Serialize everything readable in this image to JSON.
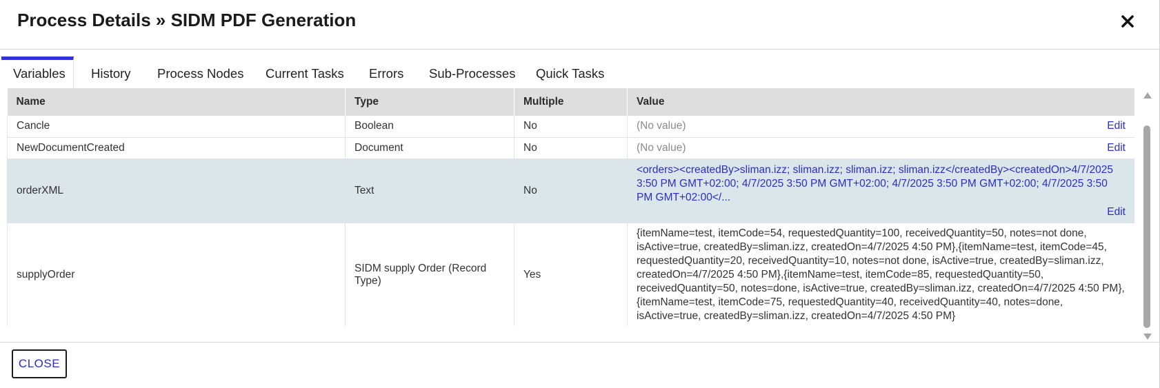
{
  "dialog": {
    "title": "Process Details » SIDM PDF Generation"
  },
  "tabs": [
    {
      "label": "Variables"
    },
    {
      "label": "History"
    },
    {
      "label": "Process Nodes"
    },
    {
      "label": "Current Tasks"
    },
    {
      "label": "Errors"
    },
    {
      "label": "Sub-Processes"
    },
    {
      "label": "Quick Tasks"
    }
  ],
  "table": {
    "headers": [
      "Name",
      "Type",
      "Multiple",
      "Value"
    ],
    "rows": [
      {
        "name": "Cancle",
        "type": "Boolean",
        "multiple": "No",
        "value": "(No value)",
        "edit": "Edit"
      },
      {
        "name": "NewDocumentCreated",
        "type": "Document",
        "multiple": "No",
        "value": "(No value)",
        "edit": "Edit"
      },
      {
        "name": "orderXML",
        "type": "Text",
        "multiple": "No",
        "value": "<orders><createdBy>sliman.izz; sliman.izz; sliman.izz; sliman.izz</createdBy><createdOn>4/7/2025 3:50 PM GMT+02:00; 4/7/2025 3:50 PM GMT+02:00; 4/7/2025 3:50 PM GMT+02:00; 4/7/2025 3:50 PM GMT+02:00</...",
        "edit": "Edit"
      },
      {
        "name": "supplyOrder",
        "type": "SIDM supply Order (Record Type)",
        "multiple": "Yes",
        "value": "{itemName=test, itemCode=54, requestedQuantity=100, receivedQuantity=50, notes=not done, isActive=true, createdBy=sliman.izz, createdOn=4/7/2025 4:50 PM},{itemName=test, itemCode=45, requestedQuantity=20, receivedQuantity=10, notes=not done, isActive=true, createdBy=sliman.izz, createdOn=4/7/2025 4:50 PM},{itemName=test, itemCode=85, requestedQuantity=50, receivedQuantity=50, notes=done, isActive=true, createdBy=sliman.izz, createdOn=4/7/2025 4:50 PM},{itemName=test, itemCode=75, requestedQuantity=40, receivedQuantity=40, notes=done, isActive=true, createdBy=sliman.izz, createdOn=4/7/2025 4:50 PM}"
      }
    ]
  },
  "footer": {
    "close_label": "CLOSE"
  },
  "colors": {
    "accent": "#2f33d6",
    "link": "#2a2ec4",
    "selected_row": "#dbe6ea",
    "header_bg": "#dedede"
  },
  "icons": {
    "close": "close-icon",
    "scroll_up": "scroll-up-arrow-icon",
    "scroll_down": "scroll-down-arrow-icon"
  }
}
